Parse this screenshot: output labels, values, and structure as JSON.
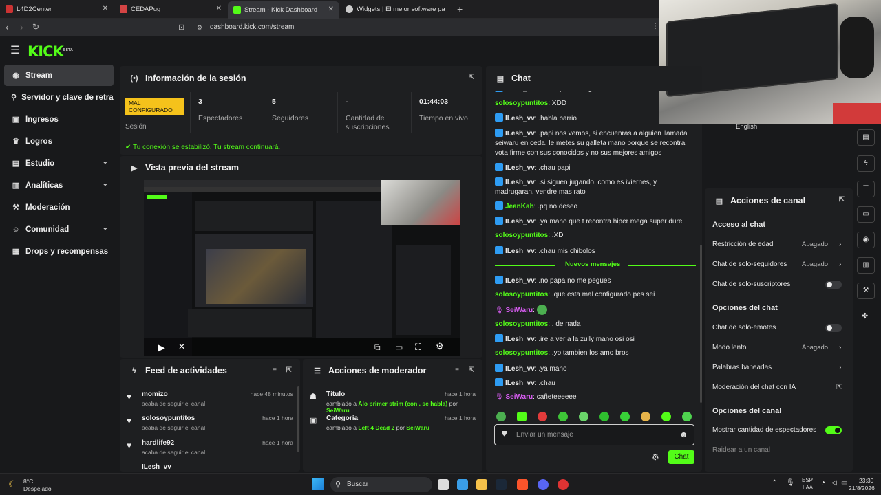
{
  "browser": {
    "tabs": [
      {
        "label": "L4D2Center",
        "color": "#cc3333"
      },
      {
        "label": "CEDAPug",
        "color": "#d44444"
      },
      {
        "label": "Stream - Kick Dashboard",
        "color": "#53fc18"
      },
      {
        "label": "Widgets | El mejor software para pod",
        "color": "#cccccc"
      }
    ],
    "url": "dashboard.kick.com/stream"
  },
  "app": {
    "logo": "KICK",
    "logo_sup": "BETA"
  },
  "sidebar": {
    "items": [
      {
        "label": "Stream",
        "icon": "broadcast-icon"
      },
      {
        "label": "Servidor y clave de retransmisión",
        "icon": "key-icon"
      },
      {
        "label": "Ingresos",
        "icon": "dollar-icon"
      },
      {
        "label": "Logros",
        "icon": "trophy-icon"
      },
      {
        "label": "Estudio",
        "icon": "studio-icon"
      },
      {
        "label": "Analíticas",
        "icon": "chart-icon"
      },
      {
        "label": "Moderación",
        "icon": "hammer-icon"
      },
      {
        "label": "Comunidad",
        "icon": "community-icon"
      },
      {
        "label": "Drops y recompensas",
        "icon": "gift-icon"
      }
    ]
  },
  "session": {
    "title": "Información de la sesión",
    "badge": "MAL CONFIGURADO",
    "badge_label": "Sesión",
    "stats": [
      {
        "value": "3",
        "label": "Espectadores"
      },
      {
        "value": "5",
        "label": "Seguidores"
      },
      {
        "value": "-",
        "label": "Cantidad de suscripciones"
      },
      {
        "value": "01:44:03",
        "label": "Tiempo en vivo"
      }
    ],
    "status": "Tu conexión se estabilizó. Tu stream continuará."
  },
  "preview": {
    "title": "Vista previa del stream"
  },
  "activity": {
    "title": "Feed de actividades",
    "items": [
      {
        "name": "momizo",
        "action": "acaba de seguir el canal",
        "time": "hace 48 minutos"
      },
      {
        "name": "solosoypuntitos",
        "action": "acaba de seguir el canal",
        "time": "hace 1 hora"
      },
      {
        "name": "hardlife92",
        "action": "acaba de seguir el canal",
        "time": "hace 1 hora"
      },
      {
        "name": "ILesh_vv",
        "action": "",
        "time": ""
      }
    ]
  },
  "modactions": {
    "title": "Acciones de moderador",
    "items": [
      {
        "label": "Título",
        "pre": "cambiado a",
        "value": "Alo primer strim (con . se habla)",
        "by": "por",
        "user": "SeiWaru",
        "time": "hace 1 hora"
      },
      {
        "label": "Categoría",
        "pre": "cambiado a",
        "value": "Left 4 Dead 2",
        "by": "por",
        "user": "SeiWaru",
        "time": "hace 1 hora"
      }
    ]
  },
  "chat": {
    "title": "Chat",
    "new_messages": "Nuevos mensajes",
    "messages": [
      {
        "user": "ILesh_vv",
        "color": "#e6e6e6",
        "badge": true,
        "text": ".mano ponte sergio"
      },
      {
        "user": "solosoypuntitos",
        "color": "#53fc18",
        "badge": false,
        "text": "XDD"
      },
      {
        "user": "ILesh_vv",
        "color": "#e6e6e6",
        "badge": true,
        "text": ".habla barrio"
      },
      {
        "user": "ILesh_vv",
        "color": "#e6e6e6",
        "badge": true,
        "text": ".papi nos vemos, si encuenras a alguien llamada seiwaru en ceda, le metes su galleta mano porque se recontra vota firme con sus conocidos y no sus mejores amigos"
      },
      {
        "user": "ILesh_vv",
        "color": "#e6e6e6",
        "badge": true,
        "text": ".chau papi"
      },
      {
        "user": "ILesh_vv",
        "color": "#e6e6e6",
        "badge": true,
        "text": ".si siguen jugando, como es iviernes, y madrugaran, vendre mas rato"
      },
      {
        "user": "JeanKah",
        "color": "#53fc18",
        "badge": true,
        "text": ".pq no deseo"
      },
      {
        "user": "ILesh_vv",
        "color": "#e6e6e6",
        "badge": true,
        "text": ".ya mano que t recontra hiper mega super dure"
      },
      {
        "user": "solosoypuntitos",
        "color": "#53fc18",
        "badge": false,
        "text": ".XD"
      },
      {
        "user": "ILesh_vv",
        "color": "#e6e6e6",
        "badge": true,
        "text": ".chau mis chibolos"
      },
      {
        "user": "ILesh_vv",
        "color": "#e6e6e6",
        "badge": true,
        "text": ".no papa no me pegues"
      },
      {
        "user": "solosoypuntitos",
        "color": "#53fc18",
        "badge": false,
        "text": ".que esta mal configurado pes sei"
      },
      {
        "user": "SeiWaru",
        "color": "#d65cf0",
        "badge": false,
        "text": ""
      },
      {
        "user": "solosoypuntitos",
        "color": "#53fc18",
        "badge": false,
        "text": ". de nada"
      },
      {
        "user": "ILesh_vv",
        "color": "#e6e6e6",
        "badge": true,
        "text": ".ire a ver a la zully mano osi osi"
      },
      {
        "user": "solosoypuntitos",
        "color": "#53fc18",
        "badge": false,
        "text": ".yo tambien los amo bros"
      },
      {
        "user": "ILesh_vv",
        "color": "#e6e6e6",
        "badge": true,
        "text": ".ya mano"
      },
      {
        "user": "ILesh_vv",
        "color": "#e6e6e6",
        "badge": true,
        "text": ".chau"
      },
      {
        "user": "SeiWaru",
        "color": "#d65cf0",
        "badge": false,
        "text": "cañeteeeeee"
      }
    ],
    "input_placeholder": "Enviar un mensaje",
    "send_label": "Chat"
  },
  "channel": {
    "language": "English",
    "title": "Acciones de canal",
    "sections": [
      {
        "heading": "Acceso al chat",
        "rows": [
          {
            "label": "Restricción de edad",
            "value": "Apagado",
            "kind": "arrow"
          },
          {
            "label": "Chat de solo-seguidores",
            "value": "Apagado",
            "kind": "arrow"
          },
          {
            "label": "Chat de solo-suscriptores",
            "value": "",
            "kind": "toggle-off"
          }
        ]
      },
      {
        "heading": "Opciones del chat",
        "rows": [
          {
            "label": "Chat de solo-emotes",
            "value": "",
            "kind": "toggle-off"
          },
          {
            "label": "Modo lento",
            "value": "Apagado",
            "kind": "arrow"
          },
          {
            "label": "Palabras baneadas",
            "value": "",
            "kind": "arrow"
          },
          {
            "label": "Moderación del chat con IA",
            "value": "",
            "kind": "external"
          }
        ]
      },
      {
        "heading": "Opciones del canal",
        "rows": [
          {
            "label": "Mostrar cantidad de espectadores",
            "value": "",
            "kind": "toggle-on"
          },
          {
            "label": "Raidear a un canal",
            "value": "",
            "kind": "dim"
          }
        ]
      }
    ]
  },
  "taskbar": {
    "weather_temp": "8°C",
    "weather_desc": "Despejado",
    "search": "Buscar",
    "lang1": "ESP",
    "lang2": "LAA",
    "time": "23:30",
    "date": "21/8/2026"
  },
  "colors": {
    "accent": "#53fc18",
    "badge": "#f5c21b",
    "vip": "#2e9cf3",
    "sub": "#d65cf0"
  }
}
